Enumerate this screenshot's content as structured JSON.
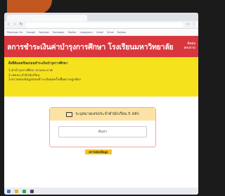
{
  "browser": {
    "tab_title": "",
    "url": "",
    "bookmarks": [
      "Pokemon Go",
      "Google",
      "Youtube",
      "Facebook",
      "Twitter",
      "Instagram",
      "Gmail",
      "Drive",
      "Roblox"
    ]
  },
  "header": {
    "title": "ลการชำระเงินค่าบำรุงการศึกษา โรงเรียนมหาวิทยาลัย",
    "right_lines": [
      "ติดต่อ",
      "สอบถาม"
    ]
  },
  "info": {
    "heading": "สิ่งที่ต้องเตรียมก่อนชำระเงินบำรุงการศึกษา",
    "lines": [
      "1.ค่าบำรุงการศึกษา ตามประกาศ",
      "2.เลขประจำตัวนักเรียน",
      "3.ตรวจสอบข้อมูลก่อนชำระเงินทุกครั้งเพื่อความถูกต้อง"
    ]
  },
  "card": {
    "title": "ระบุหมายเลขประจำตัวนักเรียน 5 หลัก",
    "field_placeholder": "ค้นหา"
  },
  "submit_label": "ตรวจสอบข้อมูล",
  "colors": {
    "header_red": "#d9363e",
    "info_yellow": "#f5e21c",
    "card_header": "#fce3a3",
    "button_gold": "#f3c322"
  }
}
